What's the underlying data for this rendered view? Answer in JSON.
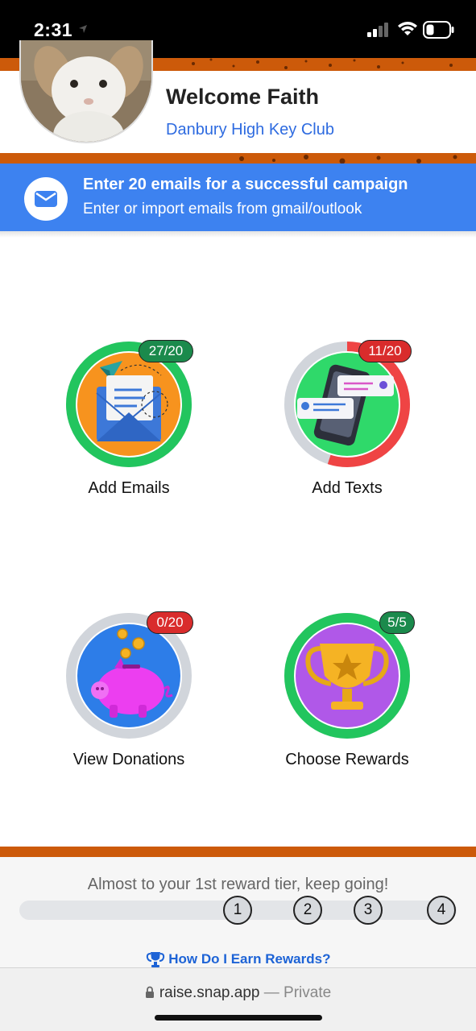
{
  "status_bar": {
    "time": "2:31"
  },
  "header": {
    "welcome": "Welcome Faith",
    "club": "Danbury High Key Club"
  },
  "banner": {
    "title": "Enter 20 emails for a successful campaign",
    "subtitle": "Enter or import emails from gmail/outlook"
  },
  "tiles": [
    {
      "label": "Add Emails",
      "badge": "27/20",
      "progress": 1.0,
      "ring_color": "#22c55e",
      "badge_color": "#1b8a4c",
      "inner_color": "#f7931e"
    },
    {
      "label": "Add Texts",
      "badge": "11/20",
      "progress": 0.55,
      "ring_color": "#ef4444",
      "badge_color": "#d92c2c",
      "inner_color": "#2fd96a"
    },
    {
      "label": "View Donations",
      "badge": "0/20",
      "progress": 0.0,
      "ring_color": "#d1d5db",
      "badge_color": "#d92c2c",
      "inner_color": "#2d7de8"
    },
    {
      "label": "Choose Rewards",
      "badge": "5/5",
      "progress": 1.0,
      "ring_color": "#22c55e",
      "badge_color": "#1b8a4c",
      "inner_color": "#b058e8"
    }
  ],
  "footer": {
    "progress_text": "Almost to your 1st reward tier, keep going!",
    "tiers": [
      "1",
      "2",
      "3",
      "4"
    ],
    "earn_link": "How Do I Earn Rewards?"
  },
  "browser": {
    "url": "raise.snap.app",
    "private": "— Private"
  },
  "colors": {
    "brand_orange": "#cc5a0a",
    "banner_blue": "#3d82f0",
    "link_blue": "#2e6be0"
  }
}
